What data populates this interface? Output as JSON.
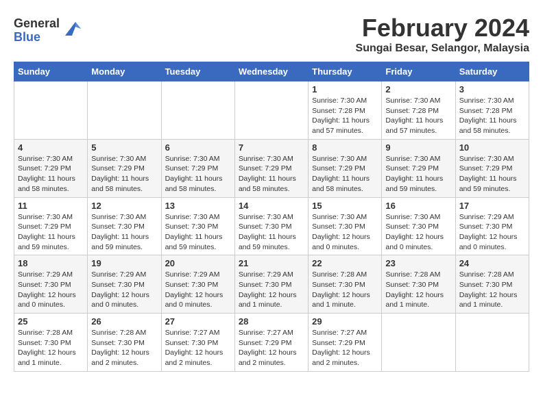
{
  "header": {
    "logo_general": "General",
    "logo_blue": "Blue",
    "month_title": "February 2024",
    "location": "Sungai Besar, Selangor, Malaysia"
  },
  "days_of_week": [
    "Sunday",
    "Monday",
    "Tuesday",
    "Wednesday",
    "Thursday",
    "Friday",
    "Saturday"
  ],
  "weeks": [
    [
      {
        "day": "",
        "info": ""
      },
      {
        "day": "",
        "info": ""
      },
      {
        "day": "",
        "info": ""
      },
      {
        "day": "",
        "info": ""
      },
      {
        "day": "1",
        "info": "Sunrise: 7:30 AM\nSunset: 7:28 PM\nDaylight: 11 hours and 57 minutes."
      },
      {
        "day": "2",
        "info": "Sunrise: 7:30 AM\nSunset: 7:28 PM\nDaylight: 11 hours and 57 minutes."
      },
      {
        "day": "3",
        "info": "Sunrise: 7:30 AM\nSunset: 7:28 PM\nDaylight: 11 hours and 58 minutes."
      }
    ],
    [
      {
        "day": "4",
        "info": "Sunrise: 7:30 AM\nSunset: 7:29 PM\nDaylight: 11 hours and 58 minutes."
      },
      {
        "day": "5",
        "info": "Sunrise: 7:30 AM\nSunset: 7:29 PM\nDaylight: 11 hours and 58 minutes."
      },
      {
        "day": "6",
        "info": "Sunrise: 7:30 AM\nSunset: 7:29 PM\nDaylight: 11 hours and 58 minutes."
      },
      {
        "day": "7",
        "info": "Sunrise: 7:30 AM\nSunset: 7:29 PM\nDaylight: 11 hours and 58 minutes."
      },
      {
        "day": "8",
        "info": "Sunrise: 7:30 AM\nSunset: 7:29 PM\nDaylight: 11 hours and 58 minutes."
      },
      {
        "day": "9",
        "info": "Sunrise: 7:30 AM\nSunset: 7:29 PM\nDaylight: 11 hours and 59 minutes."
      },
      {
        "day": "10",
        "info": "Sunrise: 7:30 AM\nSunset: 7:29 PM\nDaylight: 11 hours and 59 minutes."
      }
    ],
    [
      {
        "day": "11",
        "info": "Sunrise: 7:30 AM\nSunset: 7:29 PM\nDaylight: 11 hours and 59 minutes."
      },
      {
        "day": "12",
        "info": "Sunrise: 7:30 AM\nSunset: 7:30 PM\nDaylight: 11 hours and 59 minutes."
      },
      {
        "day": "13",
        "info": "Sunrise: 7:30 AM\nSunset: 7:30 PM\nDaylight: 11 hours and 59 minutes."
      },
      {
        "day": "14",
        "info": "Sunrise: 7:30 AM\nSunset: 7:30 PM\nDaylight: 11 hours and 59 minutes."
      },
      {
        "day": "15",
        "info": "Sunrise: 7:30 AM\nSunset: 7:30 PM\nDaylight: 12 hours and 0 minutes."
      },
      {
        "day": "16",
        "info": "Sunrise: 7:30 AM\nSunset: 7:30 PM\nDaylight: 12 hours and 0 minutes."
      },
      {
        "day": "17",
        "info": "Sunrise: 7:29 AM\nSunset: 7:30 PM\nDaylight: 12 hours and 0 minutes."
      }
    ],
    [
      {
        "day": "18",
        "info": "Sunrise: 7:29 AM\nSunset: 7:30 PM\nDaylight: 12 hours and 0 minutes."
      },
      {
        "day": "19",
        "info": "Sunrise: 7:29 AM\nSunset: 7:30 PM\nDaylight: 12 hours and 0 minutes."
      },
      {
        "day": "20",
        "info": "Sunrise: 7:29 AM\nSunset: 7:30 PM\nDaylight: 12 hours and 0 minutes."
      },
      {
        "day": "21",
        "info": "Sunrise: 7:29 AM\nSunset: 7:30 PM\nDaylight: 12 hours and 1 minute."
      },
      {
        "day": "22",
        "info": "Sunrise: 7:28 AM\nSunset: 7:30 PM\nDaylight: 12 hours and 1 minute."
      },
      {
        "day": "23",
        "info": "Sunrise: 7:28 AM\nSunset: 7:30 PM\nDaylight: 12 hours and 1 minute."
      },
      {
        "day": "24",
        "info": "Sunrise: 7:28 AM\nSunset: 7:30 PM\nDaylight: 12 hours and 1 minute."
      }
    ],
    [
      {
        "day": "25",
        "info": "Sunrise: 7:28 AM\nSunset: 7:30 PM\nDaylight: 12 hours and 1 minute."
      },
      {
        "day": "26",
        "info": "Sunrise: 7:28 AM\nSunset: 7:30 PM\nDaylight: 12 hours and 2 minutes."
      },
      {
        "day": "27",
        "info": "Sunrise: 7:27 AM\nSunset: 7:30 PM\nDaylight: 12 hours and 2 minutes."
      },
      {
        "day": "28",
        "info": "Sunrise: 7:27 AM\nSunset: 7:29 PM\nDaylight: 12 hours and 2 minutes."
      },
      {
        "day": "29",
        "info": "Sunrise: 7:27 AM\nSunset: 7:29 PM\nDaylight: 12 hours and 2 minutes."
      },
      {
        "day": "",
        "info": ""
      },
      {
        "day": "",
        "info": ""
      }
    ]
  ]
}
